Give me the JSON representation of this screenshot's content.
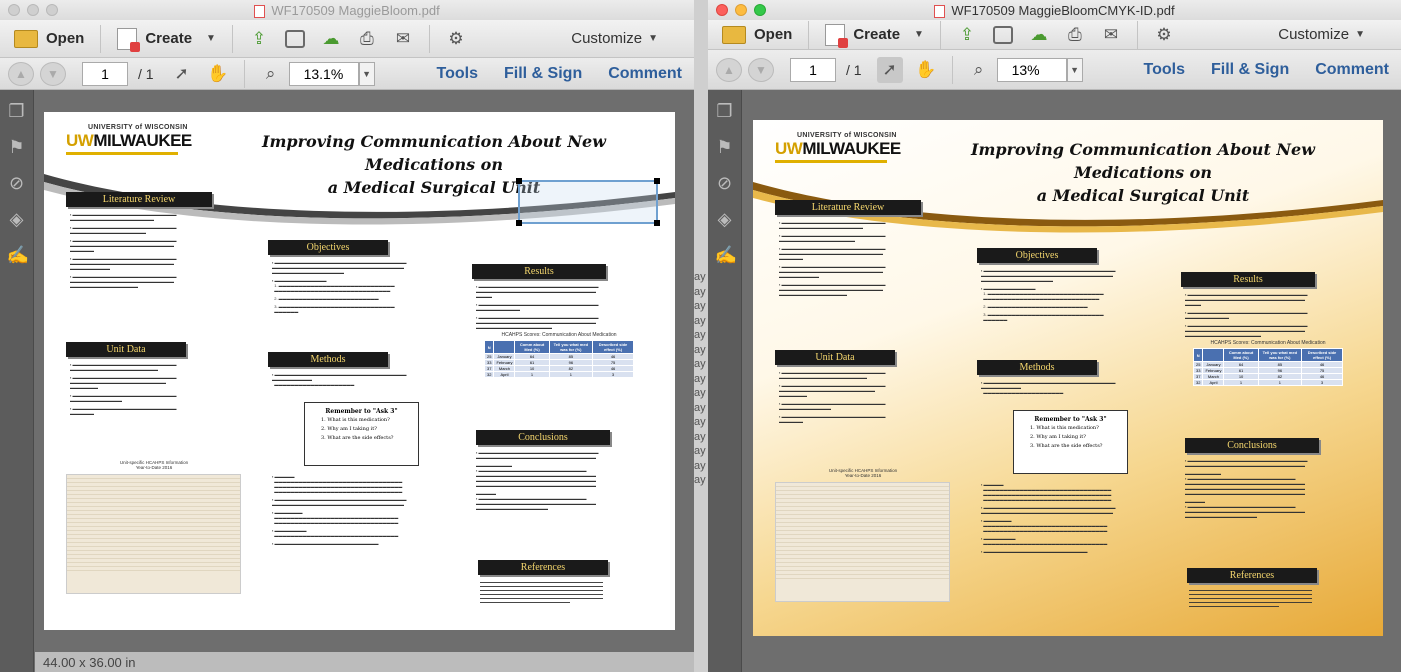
{
  "left_window": {
    "title": "WF170509 MaggieBloom.pdf",
    "toolbar": {
      "open": "Open",
      "create": "Create",
      "customize": "Customize"
    },
    "nav": {
      "page": "1",
      "total": "/ 1",
      "zoom": "13.1%"
    },
    "tabs": [
      "Tools",
      "Fill & Sign",
      "Comment"
    ],
    "status": "44.00 x 36.00 in"
  },
  "right_window": {
    "title": "WF170509 MaggieBloomCMYK-ID.pdf",
    "toolbar": {
      "open": "Open",
      "create": "Create",
      "customize": "Customize"
    },
    "nav": {
      "page": "1",
      "total": "/ 1",
      "zoom": "13%"
    },
    "tabs": [
      "Tools",
      "Fill & Sign",
      "Comment"
    ]
  },
  "background_hint": [
    "ay",
    "ay",
    "ay",
    "ay",
    "ay",
    "ay",
    "ay",
    "ay",
    "ay",
    "ay",
    "ay",
    "ay",
    "ay",
    "ay",
    "ay"
  ],
  "poster": {
    "logo_top": "UNIVERSITY of WISCONSIN",
    "logo_uw": "UW",
    "logo_main": "MILWAUKEE",
    "title_line1": "Improving Communication About New Medications on",
    "title_line2": "a Medical Surgical Unit",
    "sections": {
      "lit": "Literature Review",
      "unit": "Unit Data",
      "objectives": "Objectives",
      "methods": "Methods",
      "results": "Results",
      "conclusions": "Conclusions",
      "references": "References"
    },
    "remember": {
      "title": "Remember to \"Ask 3\"",
      "q1": "1. What is this medication?",
      "q2": "2. Why am I taking it?",
      "q3": "3. What are the side effects?"
    },
    "hcahps_title": "HCAHPS Scores: Communication About Medication",
    "hcahps_headers": [
      "N",
      "",
      "Comm about Med (%)",
      "Tell you what med was for (%)",
      "Described side effect (%)"
    ],
    "hcahps_rows": [
      [
        "25",
        "January",
        "64",
        "85",
        "46"
      ],
      [
        "33",
        "February",
        "61",
        "96",
        "75"
      ],
      [
        "37",
        "March",
        "10",
        "82",
        "46"
      ],
      [
        "32",
        "April",
        "1",
        "1",
        "3"
      ]
    ],
    "unit_title_line1": "Unit-specific HCAHPS Information",
    "unit_title_line2": "Year-to-Date 2016"
  }
}
